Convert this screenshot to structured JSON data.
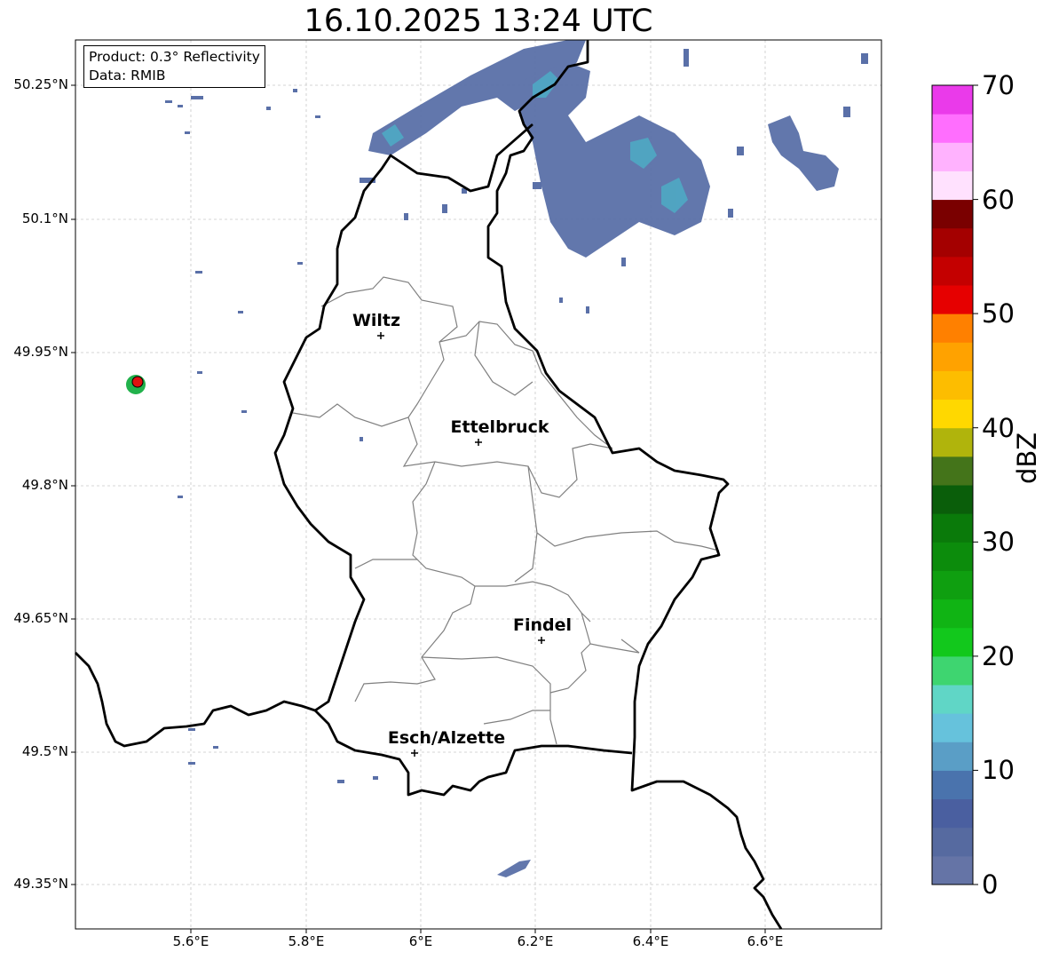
{
  "title": "16.10.2025 13:24 UTC",
  "info_box": {
    "product": "Product: 0.3° Reflectivity",
    "data": "Data: RMIB"
  },
  "axes": {
    "lat_labels": [
      "50.25°N",
      "50.1°N",
      "49.95°N",
      "49.8°N",
      "49.65°N",
      "49.5°N",
      "49.35°N"
    ],
    "lon_labels": [
      "5.6°E",
      "5.8°E",
      "6°E",
      "6.2°E",
      "6.4°E",
      "6.6°E"
    ]
  },
  "colorbar": {
    "label": "dBZ",
    "ticks": [
      "0",
      "10",
      "20",
      "30",
      "40",
      "50",
      "60",
      "70"
    ],
    "colors": [
      "#6574a6",
      "#566aa0",
      "#4a5fa0",
      "#4a73ad",
      "#5a9ec6",
      "#66c2dc",
      "#60d6c6",
      "#3ed570",
      "#12c81c",
      "#10b414",
      "#0f9f10",
      "#0c8c0c",
      "#0a7a0a",
      "#0a5e0a",
      "#44741a",
      "#b0b40c",
      "#ffd800",
      "#fdbd00",
      "#ffa200",
      "#ff8000",
      "#e60000",
      "#c40000",
      "#a40000",
      "#7a0000",
      "#ffe1fe",
      "#ffb2fe",
      "#ff6efe",
      "#ea3aea"
    ]
  },
  "cities": [
    {
      "name": "Wiltz"
    },
    {
      "name": "Ettelbruck"
    },
    {
      "name": "Findel"
    },
    {
      "name": "Esch/Alzette"
    }
  ],
  "colors": {
    "radar_echo": "#5a70a8",
    "radar_echo_light": "#4fa9c4",
    "border": "#000000",
    "canton_border": "#808080",
    "grid": "#c0c0c0",
    "radar_site": "#e01010"
  }
}
